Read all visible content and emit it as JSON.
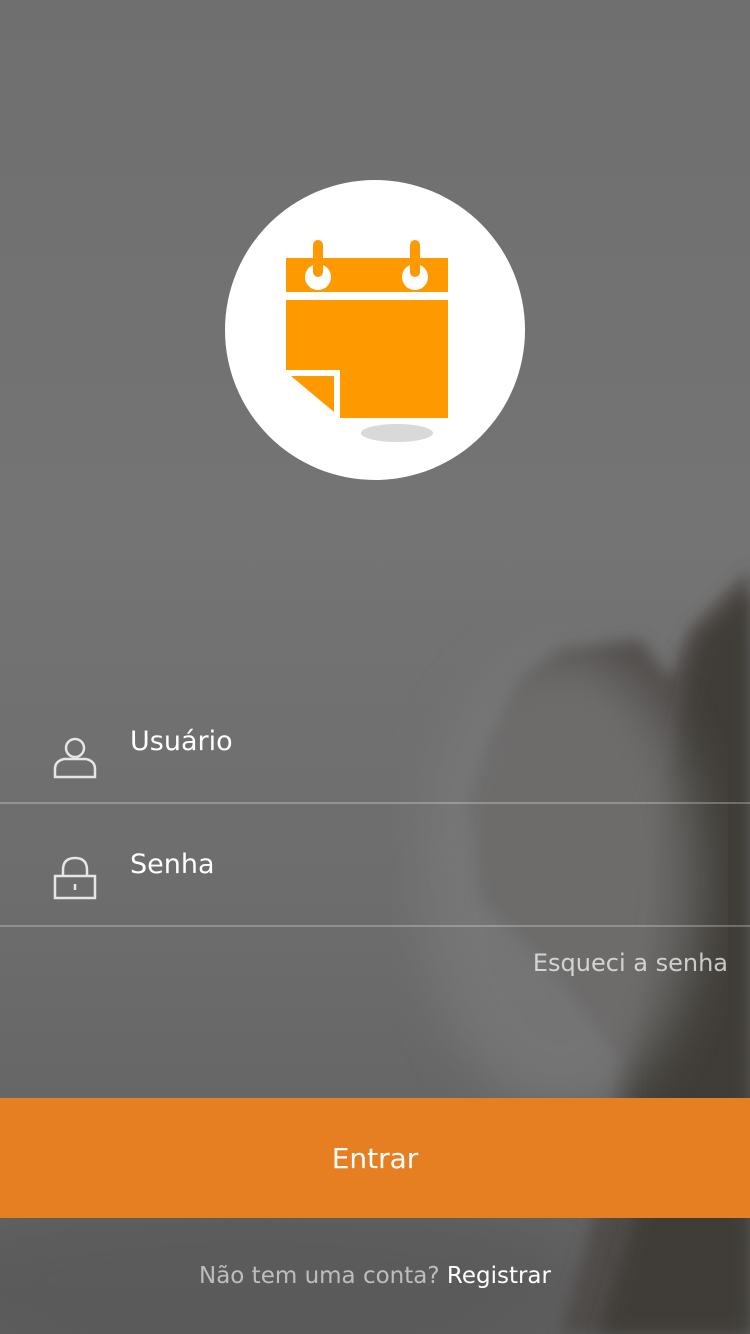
{
  "logo": {
    "icon": "calendar-note-icon",
    "accent_color": "#ff9900"
  },
  "login_form": {
    "username": {
      "placeholder": "Usuário",
      "value": "",
      "icon": "user-icon"
    },
    "password": {
      "placeholder": "Senha",
      "value": "",
      "icon": "lock-icon"
    },
    "forgot_password_label": "Esqueci a senha",
    "submit_label": "Entrar",
    "button_color": "#e67e22"
  },
  "register": {
    "prompt": "Não tem uma conta?",
    "link_label": "Registrar"
  }
}
